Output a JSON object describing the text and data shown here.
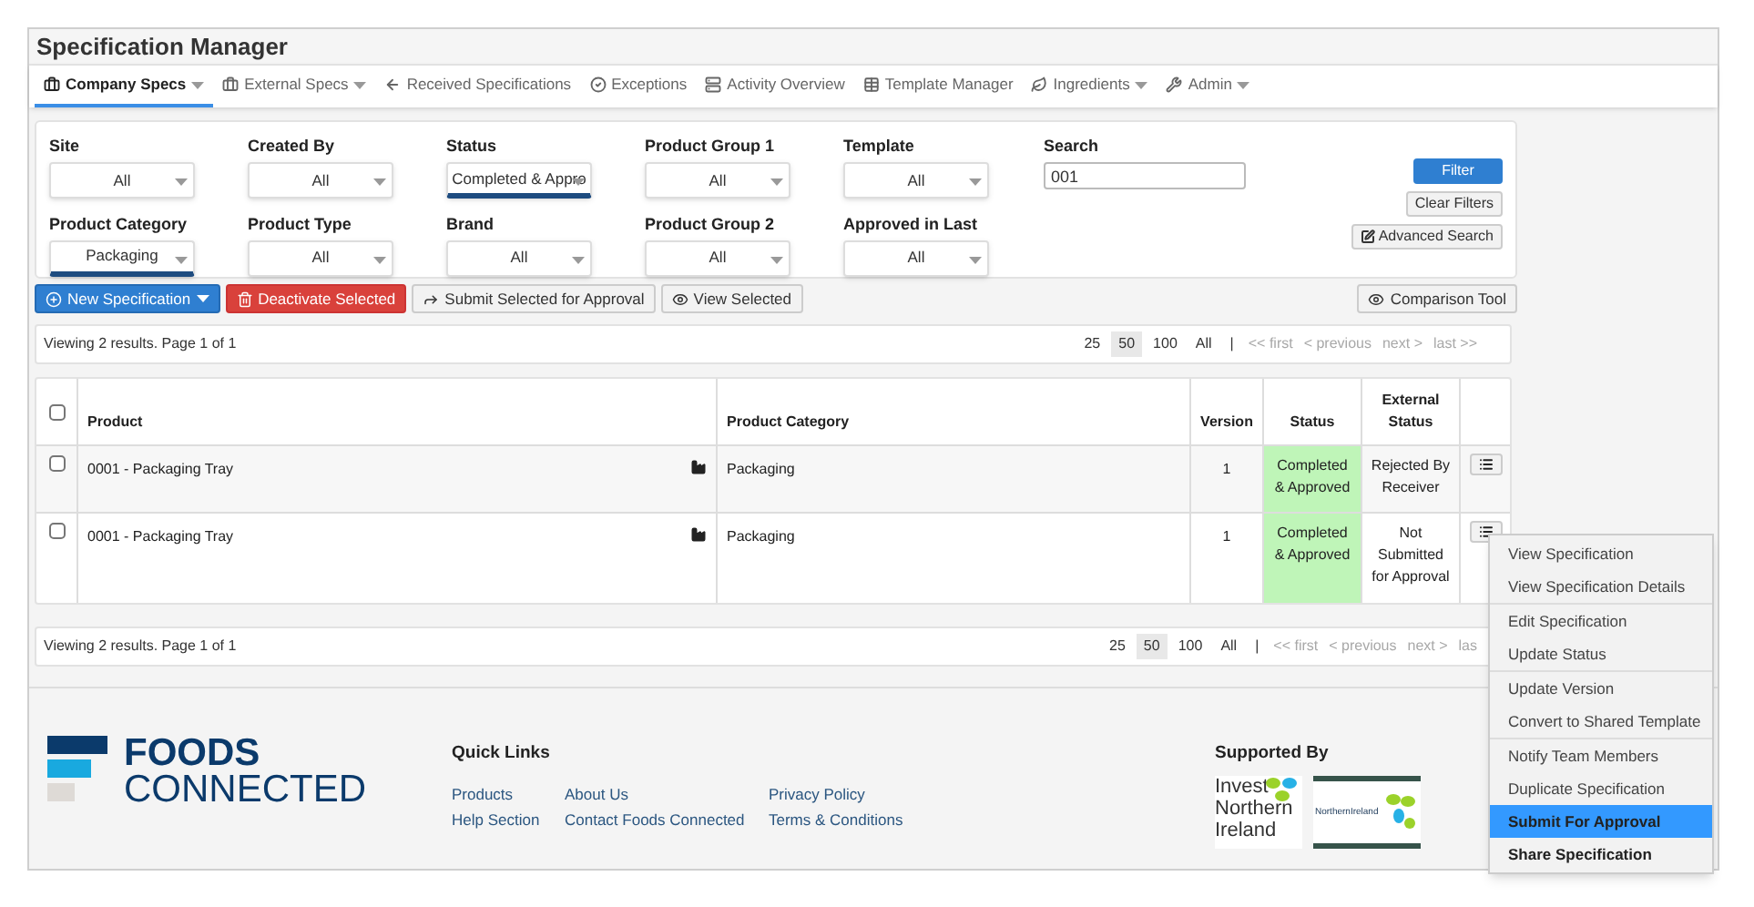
{
  "title": "Specification Manager",
  "tabs": [
    {
      "label": "Company Specs",
      "selected": true,
      "caret": true
    },
    {
      "label": "External Specs",
      "selected": false,
      "caret": true
    },
    {
      "label": "Received Specifications",
      "selected": false,
      "caret": false
    },
    {
      "label": "Exceptions",
      "selected": false,
      "caret": false
    },
    {
      "label": "Activity Overview",
      "selected": false,
      "caret": false
    },
    {
      "label": "Template Manager",
      "selected": false,
      "caret": false
    },
    {
      "label": "Ingredients",
      "selected": false,
      "caret": true
    },
    {
      "label": "Admin",
      "selected": false,
      "caret": true
    }
  ],
  "filters": [
    {
      "label": "Site",
      "value": "All",
      "kind": "select",
      "focused": false
    },
    {
      "label": "Created By",
      "value": "All",
      "kind": "select",
      "focused": false
    },
    {
      "label": "Status",
      "value": "Completed & Appro",
      "kind": "select",
      "focused": true
    },
    {
      "label": "Product Group 1",
      "value": "All",
      "kind": "select",
      "focused": false
    },
    {
      "label": "Template",
      "value": "All",
      "kind": "select",
      "focused": false
    },
    {
      "label": "Search",
      "value": "001",
      "kind": "text",
      "focused": false
    },
    {
      "label": "Product Category",
      "value": "Packaging",
      "kind": "select",
      "focused": true
    },
    {
      "label": "Product Type",
      "value": "All",
      "kind": "select",
      "focused": false
    },
    {
      "label": "Brand",
      "value": "All",
      "kind": "select",
      "focused": false
    },
    {
      "label": "Product Group 2",
      "value": "All",
      "kind": "select",
      "focused": false
    },
    {
      "label": "Approved in Last",
      "value": "All",
      "kind": "select",
      "focused": false
    }
  ],
  "filter_buttons": [
    {
      "label": "Filter",
      "kind": "primary"
    },
    {
      "label": "Clear Filters",
      "kind": "plain"
    },
    {
      "label": "Advanced Search",
      "kind": "edit"
    }
  ],
  "actions": [
    {
      "label": "New Specification",
      "kind": "new"
    },
    {
      "label": "Deactivate Selected",
      "kind": "danger"
    },
    {
      "label": "Submit Selected for Approval",
      "kind": "submit"
    },
    {
      "label": "View Selected",
      "kind": "view"
    }
  ],
  "comparison_tool": "Comparison Tool",
  "pagers": [
    {
      "summary": "Viewing 2 results. Page 1 of 1",
      "sizes": [
        {
          "label": "25",
          "selected": false
        },
        {
          "label": "50",
          "selected": true
        },
        {
          "label": "100",
          "selected": false
        },
        {
          "label": "All",
          "selected": false
        }
      ],
      "separator": "|",
      "links": [
        {
          "label": "<< first",
          "disabled": true
        },
        {
          "label": "< previous",
          "disabled": true
        },
        {
          "label": "next >",
          "disabled": true
        },
        {
          "label": "last >>",
          "disabled": true
        }
      ]
    },
    {
      "summary": "Viewing 2 results. Page 1 of 1",
      "sizes": [
        {
          "label": "25",
          "selected": false
        },
        {
          "label": "50",
          "selected": true
        },
        {
          "label": "100",
          "selected": false
        },
        {
          "label": "All",
          "selected": false
        }
      ],
      "separator": "|",
      "links": [
        {
          "label": "<< first",
          "disabled": true
        },
        {
          "label": "< previous",
          "disabled": true
        },
        {
          "label": "next >",
          "disabled": true
        },
        {
          "label": "las",
          "disabled": true
        }
      ]
    }
  ],
  "table": {
    "select_all_checked": false,
    "columns": [
      "Product",
      "Product Category",
      "Version",
      "Status",
      "External Status"
    ],
    "rows": [
      {
        "checked": false,
        "product": "0001 - Packaging Tray",
        "category": "Packaging",
        "version": "1",
        "status": "Completed & Approved",
        "external_status": "Rejected By Receiver"
      },
      {
        "checked": false,
        "product": "0001 - Packaging Tray",
        "category": "Packaging",
        "version": "1",
        "status": "Completed & Approved",
        "external_status": "Not Submitted for Approval"
      }
    ]
  },
  "menu": [
    [
      {
        "label": "View Specification",
        "selected": false,
        "bold": false
      },
      {
        "label": "View Specification Details",
        "selected": false,
        "bold": false
      }
    ],
    [
      {
        "label": "Edit Specification",
        "selected": false,
        "bold": false
      },
      {
        "label": "Update Status",
        "selected": false,
        "bold": false
      }
    ],
    [
      {
        "label": "Update Version",
        "selected": false,
        "bold": false
      },
      {
        "label": "Convert to Shared Template",
        "selected": false,
        "bold": false
      }
    ],
    [
      {
        "label": "Notify Team Members",
        "selected": false,
        "bold": false
      },
      {
        "label": "Duplicate Specification",
        "selected": false,
        "bold": false
      },
      {
        "label": "Submit For Approval",
        "selected": true,
        "bold": true
      },
      {
        "label": "Share Specification",
        "selected": false,
        "bold": true
      }
    ]
  ],
  "footer": {
    "logo_top": "FOODS",
    "logo_bottom": "CONNECTED",
    "quick_links_title": "Quick Links",
    "links": [
      "Products",
      "Help Section",
      "About Us",
      "Contact Foods Connected",
      "Privacy Policy",
      "Terms & Conditions"
    ],
    "supported_by": "Supported By",
    "invest_logo": "Invest Northern Ireland",
    "ni_logo": "NorthernIreland"
  }
}
